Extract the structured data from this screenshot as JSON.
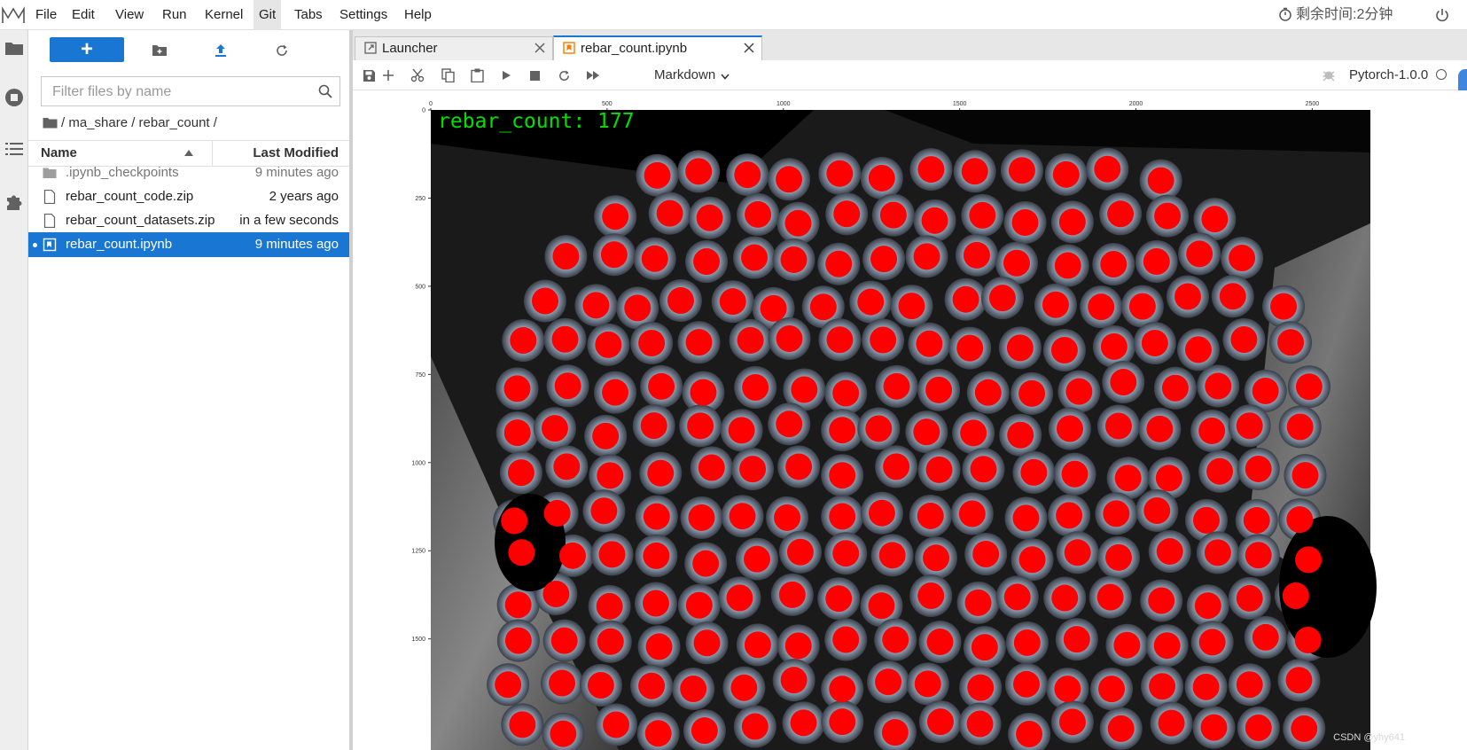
{
  "menu": {
    "items": [
      {
        "label": "File"
      },
      {
        "label": "Edit"
      },
      {
        "label": "View"
      },
      {
        "label": "Run"
      },
      {
        "label": "Kernel"
      },
      {
        "label": "Git"
      },
      {
        "label": "Tabs"
      },
      {
        "label": "Settings"
      },
      {
        "label": "Help"
      }
    ],
    "timer": "剩余时间:2分钟"
  },
  "filebrowser": {
    "new_button": "+",
    "search_placeholder": "Filter files by name",
    "breadcrumb": "/ ma_share / rebar_count /",
    "columns": {
      "name": "Name",
      "modified": "Last Modified"
    },
    "files": [
      {
        "name": ".ipynb_checkpoints",
        "modified": "9 minutes ago",
        "type": "folder"
      },
      {
        "name": "rebar_count_code.zip",
        "modified": "2 years ago",
        "type": "file"
      },
      {
        "name": "rebar_count_datasets.zip",
        "modified": "in a few seconds",
        "type": "file"
      },
      {
        "name": "rebar_count.ipynb",
        "modified": "9 minutes ago",
        "type": "notebook",
        "selected": true
      }
    ]
  },
  "tabs": [
    {
      "label": "Launcher"
    },
    {
      "label": "rebar_count.ipynb",
      "active": true
    }
  ],
  "toolbar": {
    "cell_type": "Markdown",
    "kernel": "Pytorch-1.0.0"
  },
  "figure": {
    "overlay_text": "rebar_count: 177",
    "x_ticks": [
      "0",
      "500",
      "1000",
      "1500",
      "2000",
      "2500"
    ],
    "y_ticks": [
      "0",
      "250",
      "500",
      "750",
      "1000",
      "1250",
      "1500"
    ],
    "dot_color": "#ff0000",
    "overlay_text_color": "#00e000"
  },
  "watermark": "CSDN @yhy641"
}
